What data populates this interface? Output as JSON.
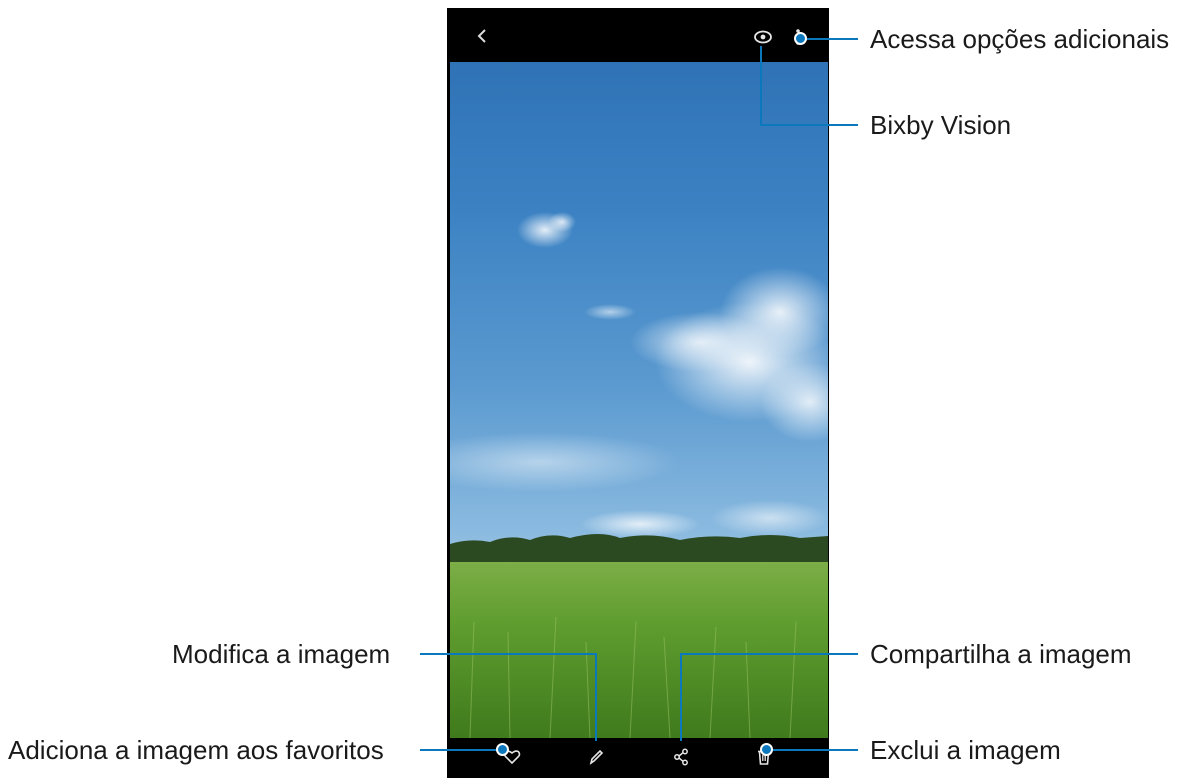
{
  "callouts": {
    "more_options": "Acessa opções adicionais",
    "bixby_vision": "Bixby Vision",
    "edit": "Modifica a imagem",
    "share": "Compartilha a imagem",
    "favorite": "Adiciona a imagem aos favoritos",
    "delete": "Exclui a imagem"
  },
  "icons": {
    "back": "chevron-left-icon",
    "vision": "eye-icon",
    "more": "more-vertical-icon",
    "favorite": "heart-icon",
    "edit": "pencil-icon",
    "share": "share-icon",
    "delete": "trash-icon"
  },
  "colors": {
    "accent": "#0b77bd",
    "toolbar": "#000000",
    "sky": "#3c82c3",
    "grass": "#5c9a2c"
  }
}
